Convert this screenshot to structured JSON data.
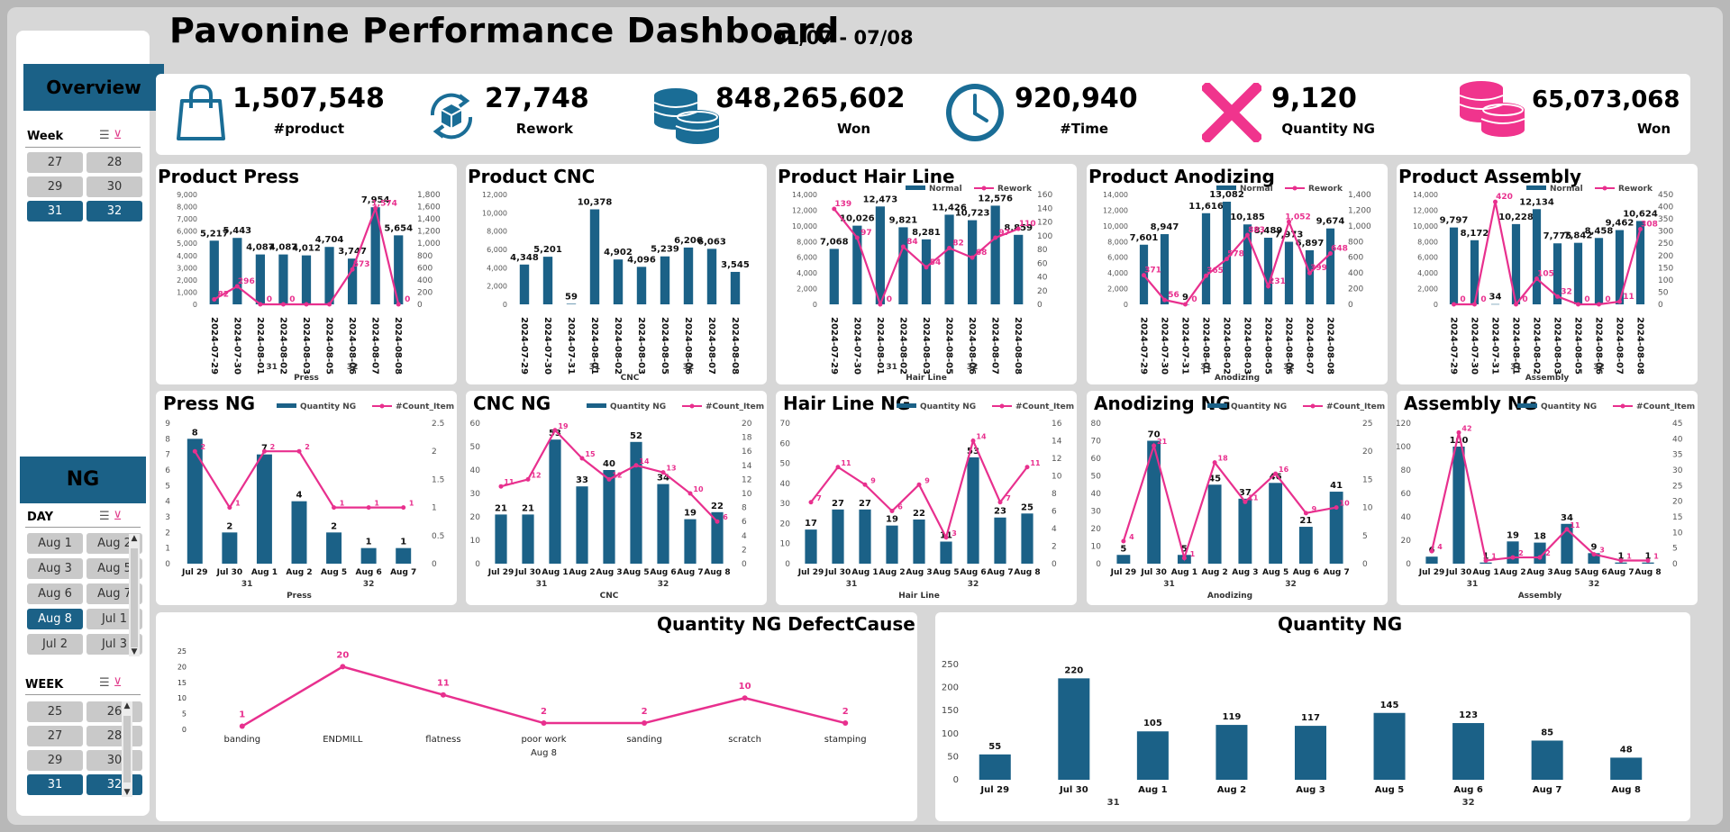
{
  "header": {
    "title": "Pavonine Performance Dashboard",
    "date_range": "01/07 - 07/08"
  },
  "colors": {
    "normal": "#1b6187",
    "rework": "#e8308e",
    "accent_blue": "#1a6d96",
    "accent_pink": "#f0348d"
  },
  "sidebar": {
    "overview": {
      "heading": "Overview",
      "week_title": "Week",
      "week_items": [
        {
          "label": "27",
          "selected": false
        },
        {
          "label": "28",
          "selected": false
        },
        {
          "label": "29",
          "selected": false
        },
        {
          "label": "30",
          "selected": false
        },
        {
          "label": "31",
          "selected": true
        },
        {
          "label": "32",
          "selected": true
        }
      ]
    },
    "ng": {
      "heading": "NG",
      "day_title": "DAY",
      "day_items": [
        {
          "label": "Aug 1",
          "selected": false
        },
        {
          "label": "Aug 2",
          "selected": false
        },
        {
          "label": "Aug 3",
          "selected": false
        },
        {
          "label": "Aug 5",
          "selected": false
        },
        {
          "label": "Aug 6",
          "selected": false
        },
        {
          "label": "Aug 7",
          "selected": false
        },
        {
          "label": "Aug 8",
          "selected": true
        },
        {
          "label": "Jul 1",
          "selected": false
        },
        {
          "label": "Jul 2",
          "selected": false
        },
        {
          "label": "Jul 3",
          "selected": false
        }
      ],
      "week_title": "WEEK",
      "week_items": [
        {
          "label": "25",
          "selected": false
        },
        {
          "label": "26",
          "selected": false
        },
        {
          "label": "27",
          "selected": false
        },
        {
          "label": "28",
          "selected": false
        },
        {
          "label": "29",
          "selected": false
        },
        {
          "label": "30",
          "selected": false
        },
        {
          "label": "31",
          "selected": true
        },
        {
          "label": "32",
          "selected": true
        }
      ]
    }
  },
  "kpis": [
    {
      "icon": "shopping-bag-icon",
      "value": "1,507,548",
      "label": "#product"
    },
    {
      "icon": "rework-box-icon",
      "value": "27,748",
      "label": "Rework"
    },
    {
      "icon": "coins-blue-icon",
      "value": "848,265,602",
      "label": "Won"
    },
    {
      "icon": "clock-icon",
      "value": "920,940",
      "label": "#Time"
    },
    {
      "icon": "cross-icon",
      "value": "9,120",
      "label": "Quantity NG"
    },
    {
      "icon": "coins-pink-icon",
      "value": "65,073,068",
      "label": "Won"
    }
  ],
  "chart_data": [
    {
      "id": "press",
      "type": "bar",
      "title": "Product Press",
      "categories": [
        "2024-07-29",
        "2024-07-30",
        "2024-08-01",
        "2024-08-02",
        "2024-08-03",
        "2024-08-05",
        "2024-08-06",
        "2024-08-07",
        "2024-08-08"
      ],
      "values": [
        5217,
        5443,
        4087,
        4087,
        4012,
        4704,
        3747,
        7954,
        5654
      ],
      "labels": [
        "5,217",
        "5,443",
        "4,087",
        "4,087",
        "4,012",
        "4,704",
        "3,747",
        "7,954",
        "5,654"
      ],
      "line": [
        82,
        296,
        0,
        0,
        0,
        0,
        572,
        1574,
        0
      ],
      "line_labels": [
        "82",
        "296",
        "0",
        "0",
        "",
        "",
        "573",
        "1,574",
        "0"
      ],
      "ylim": [
        0,
        9000
      ],
      "y_ticks": [
        "0",
        "1,000",
        "2,000",
        "3,000",
        "4,000",
        "5,000",
        "6,000",
        "7,000",
        "8,000",
        "9,000"
      ],
      "y2lim": [
        0,
        1800
      ],
      "y2_ticks": [
        "0",
        "200",
        "400",
        "600",
        "800",
        "1,000",
        "1,200",
        "1,400",
        "1,600",
        "1,800"
      ],
      "groups": [
        {
          "label": "31",
          "from": 2,
          "to": 3
        },
        {
          "label": "32",
          "from": 4,
          "to": 8
        }
      ],
      "xlabel": "Press"
    },
    {
      "id": "cnc",
      "type": "bar",
      "title": "Product CNC",
      "categories": [
        "2024-07-29",
        "2024-07-30",
        "2024-07-31",
        "2024-08-01",
        "2024-08-02",
        "2024-08-03",
        "2024-08-05",
        "2024-08-06",
        "2024-08-07",
        "2024-08-08"
      ],
      "values": [
        4348,
        5201,
        59,
        10378,
        4902,
        4096,
        5239,
        6206,
        6063,
        3545
      ],
      "labels": [
        "4,348",
        "5,201",
        "59",
        "10,378",
        "4,902",
        "4,096",
        "5,239",
        "6,206",
        "6,063",
        "3,545"
      ],
      "ylim": [
        0,
        12000
      ],
      "y_ticks": [
        "0",
        "2,000",
        "4,000",
        "6,000",
        "8,000",
        "10,000",
        "12,000"
      ],
      "groups": [
        {
          "label": "31",
          "from": 2,
          "to": 4
        },
        {
          "label": "32",
          "from": 5,
          "to": 9
        }
      ],
      "xlabel": "CNC"
    },
    {
      "id": "hairline",
      "type": "bar",
      "title": "Product Hair Line",
      "legend": [
        "Normal",
        "Rework"
      ],
      "categories": [
        "2024-07-29",
        "2024-07-30",
        "2024-08-01",
        "2024-08-02",
        "2024-08-03",
        "2024-08-05",
        "2024-08-06",
        "2024-08-07",
        "2024-08-08"
      ],
      "values": [
        7068,
        10026,
        12473,
        9821,
        8281,
        11426,
        10723,
        12576,
        8859
      ],
      "labels": [
        "7,068",
        "10,026",
        "12,473",
        "9,821",
        "8,281",
        "11,426",
        "10,723",
        "12,576",
        "8,859"
      ],
      "line": [
        139,
        97,
        0,
        84,
        54,
        82,
        68,
        97,
        110
      ],
      "line_labels": [
        "139",
        "97",
        "0",
        "84",
        "54",
        "82",
        "68",
        "97",
        "110"
      ],
      "ylim": [
        0,
        14000
      ],
      "y_ticks": [
        "0",
        "2,000",
        "4,000",
        "6,000",
        "8,000",
        "10,000",
        "12,000",
        "14,000"
      ],
      "y2lim": [
        0,
        160
      ],
      "y2_ticks": [
        "0",
        "20",
        "40",
        "60",
        "80",
        "100",
        "120",
        "140",
        "160"
      ],
      "groups": [
        {
          "label": "31",
          "from": 2,
          "to": 3
        },
        {
          "label": "32",
          "from": 4,
          "to": 8
        }
      ],
      "xlabel": "Hair Line"
    },
    {
      "id": "anodizing",
      "type": "bar",
      "title": "Product Anodizing",
      "legend": [
        "Normal",
        "Rework"
      ],
      "categories": [
        "2024-07-29",
        "2024-07-30",
        "2024-07-31",
        "2024-08-01",
        "2024-08-02",
        "2024-08-03",
        "2024-08-05",
        "2024-08-06",
        "2024-08-07",
        "2024-08-08"
      ],
      "values": [
        7601,
        8947,
        9,
        11616,
        13082,
        10185,
        8489,
        7973,
        6897,
        9674
      ],
      "labels": [
        "7,601",
        "8,947",
        "9",
        "11,616",
        "13,082",
        "10,185",
        "8,489",
        "7,973",
        "6,897",
        "9,674"
      ],
      "line": [
        371,
        56,
        0,
        365,
        578,
        883,
        231,
        1052,
        399,
        648
      ],
      "line_labels": [
        "371",
        "56",
        "0",
        "365",
        "578",
        "883",
        "231",
        "1,052",
        "399",
        "648"
      ],
      "ylim": [
        0,
        14000
      ],
      "y_ticks": [
        "0",
        "2,000",
        "4,000",
        "6,000",
        "8,000",
        "10,000",
        "12,000",
        "14,000"
      ],
      "y2lim": [
        0,
        1400
      ],
      "y2_ticks": [
        "0",
        "200",
        "400",
        "600",
        "800",
        "1,000",
        "1,200",
        "1,400"
      ],
      "groups": [
        {
          "label": "31",
          "from": 2,
          "to": 4
        },
        {
          "label": "32",
          "from": 5,
          "to": 9
        }
      ],
      "xlabel": "Anodizing"
    },
    {
      "id": "assembly",
      "type": "bar",
      "title": "Product Assembly",
      "legend": [
        "Normal",
        "Rework"
      ],
      "categories": [
        "2024-07-29",
        "2024-07-30",
        "2024-07-31",
        "2024-08-01",
        "2024-08-02",
        "2024-08-03",
        "2024-08-05",
        "2024-08-06",
        "2024-08-07",
        "2024-08-08"
      ],
      "values": [
        9797,
        8172,
        34,
        10228,
        12134,
        7775,
        7842,
        8458,
        9462,
        10624
      ],
      "labels": [
        "9,797",
        "8,172",
        "34",
        "10,228",
        "12,134",
        "7,775",
        "7,842",
        "8,458",
        "9,462",
        "10,624"
      ],
      "line": [
        0,
        0,
        420,
        0,
        105,
        32,
        0,
        0,
        11,
        308
      ],
      "line_labels": [
        "0",
        "0",
        "420",
        "0",
        "105",
        "32",
        "0",
        "0",
        "11",
        "308"
      ],
      "ylim": [
        0,
        14000
      ],
      "y_ticks": [
        "0",
        "2,000",
        "4,000",
        "6,000",
        "8,000",
        "10,000",
        "12,000",
        "14,000"
      ],
      "y2lim": [
        0,
        450
      ],
      "y2_ticks": [
        "0",
        "50",
        "100",
        "150",
        "200",
        "250",
        "300",
        "350",
        "400",
        "450"
      ],
      "groups": [
        {
          "label": "31",
          "from": 2,
          "to": 4
        },
        {
          "label": "32",
          "from": 5,
          "to": 9
        }
      ],
      "xlabel": "Assembly"
    },
    {
      "id": "press_ng",
      "type": "bar",
      "title": "Press NG",
      "legend": [
        "Quantity NG",
        "#Count_Item"
      ],
      "categories": [
        "Jul 29",
        "Jul 30",
        "Aug 1",
        "Aug 2",
        "Aug 5",
        "Aug 6",
        "Aug 7"
      ],
      "values": [
        8,
        2,
        7,
        4,
        2,
        1,
        1
      ],
      "line": [
        2,
        1,
        2,
        2,
        1,
        1,
        1
      ],
      "ylim": [
        0,
        9
      ],
      "y_ticks": [
        "0",
        "1",
        "2",
        "3",
        "4",
        "5",
        "6",
        "7",
        "8",
        "9"
      ],
      "y2lim": [
        0,
        2.5
      ],
      "y2_ticks": [
        "0",
        "0.5",
        "1",
        "1.5",
        "2",
        "2.5"
      ],
      "groups": [
        {
          "label": "31",
          "from": 0,
          "to": 3
        },
        {
          "label": "32",
          "from": 4,
          "to": 6
        }
      ],
      "xlabel": "Press"
    },
    {
      "id": "cnc_ng",
      "type": "bar",
      "title": "CNC NG",
      "legend": [
        "Quantity NG",
        "#Count_Item"
      ],
      "categories": [
        "Jul 29",
        "Jul 30",
        "Aug 1",
        "Aug 2",
        "Aug 3",
        "Aug 5",
        "Aug 6",
        "Aug 7",
        "Aug 8"
      ],
      "values": [
        21,
        21,
        53,
        33,
        40,
        52,
        34,
        19,
        22
      ],
      "line": [
        11,
        12,
        19,
        15,
        12,
        14,
        13,
        10,
        6
      ],
      "ylim": [
        0,
        60
      ],
      "y_ticks": [
        "0",
        "10",
        "20",
        "30",
        "40",
        "50",
        "60"
      ],
      "y2lim": [
        0,
        20
      ],
      "y2_ticks": [
        "0",
        "2",
        "4",
        "6",
        "8",
        "10",
        "12",
        "14",
        "16",
        "18",
        "20"
      ],
      "groups": [
        {
          "label": "31",
          "from": 0,
          "to": 3
        },
        {
          "label": "32",
          "from": 4,
          "to": 8
        }
      ],
      "xlabel": "CNC"
    },
    {
      "id": "hairline_ng",
      "type": "bar",
      "title": "Hair Line NG",
      "legend": [
        "Quantity NG",
        "#Count_Item"
      ],
      "categories": [
        "Jul 29",
        "Jul 30",
        "Aug 1",
        "Aug 2",
        "Aug 3",
        "Aug 5",
        "Aug 6",
        "Aug 7",
        "Aug 8"
      ],
      "values": [
        17,
        27,
        27,
        19,
        22,
        11,
        53,
        23,
        25
      ],
      "line": [
        7,
        11,
        9,
        6,
        9,
        3,
        14,
        7,
        11
      ],
      "ylim": [
        0,
        70
      ],
      "y_ticks": [
        "0",
        "10",
        "20",
        "30",
        "40",
        "50",
        "60",
        "70"
      ],
      "y2lim": [
        0,
        16
      ],
      "y2_ticks": [
        "0",
        "2",
        "4",
        "6",
        "8",
        "10",
        "12",
        "14",
        "16"
      ],
      "groups": [
        {
          "label": "31",
          "from": 0,
          "to": 3
        },
        {
          "label": "32",
          "from": 4,
          "to": 8
        }
      ],
      "xlabel": "Hair Line"
    },
    {
      "id": "anodizing_ng",
      "type": "bar",
      "title": "Anodizing NG",
      "legend": [
        "Quantity NG",
        "#Count_Item"
      ],
      "categories": [
        "Jul 29",
        "Jul 30",
        "Aug 1",
        "Aug 2",
        "Aug 3",
        "Aug 5",
        "Aug 6",
        "Aug 7"
      ],
      "values": [
        5,
        70,
        5,
        45,
        37,
        46,
        21,
        41
      ],
      "line": [
        4,
        21,
        1,
        18,
        11,
        16,
        9,
        10
      ],
      "ylim": [
        0,
        80
      ],
      "y_ticks": [
        "0",
        "10",
        "20",
        "30",
        "40",
        "50",
        "60",
        "70",
        "80"
      ],
      "y2lim": [
        0,
        25
      ],
      "y2_ticks": [
        "0",
        "5",
        "10",
        "15",
        "20",
        "25"
      ],
      "groups": [
        {
          "label": "31",
          "from": 0,
          "to": 3
        },
        {
          "label": "32",
          "from": 4,
          "to": 7
        }
      ],
      "xlabel": "Anodizing"
    },
    {
      "id": "assembly_ng",
      "type": "bar",
      "title": "Assembly NG",
      "legend": [
        "Quantity NG",
        "#Count_Item"
      ],
      "categories": [
        "Jul 29",
        "Jul 30",
        "Aug 1",
        "Aug 2",
        "Aug 3",
        "Aug 5",
        "Aug 6",
        "Aug 7",
        "Aug 8"
      ],
      "values": [
        6,
        100,
        1,
        19,
        18,
        34,
        9,
        1,
        1
      ],
      "line": [
        4,
        42,
        1,
        2,
        2,
        11,
        3,
        1,
        1
      ],
      "ylim": [
        0,
        120
      ],
      "y_ticks": [
        "0",
        "20",
        "40",
        "60",
        "80",
        "100",
        "120"
      ],
      "y2lim": [
        0,
        45
      ],
      "y2_ticks": [
        "0",
        "5",
        "10",
        "15",
        "20",
        "25",
        "30",
        "35",
        "40",
        "45"
      ],
      "groups": [
        {
          "label": "31",
          "from": 0,
          "to": 3
        },
        {
          "label": "32",
          "from": 4,
          "to": 8
        }
      ],
      "xlabel": "Assembly"
    },
    {
      "id": "defect_cause",
      "type": "line",
      "title": "Quantity NG DefectCause",
      "categories": [
        "banding",
        "ENDMILL",
        "flatness",
        "poor work",
        "sanding",
        "scratch",
        "stamping"
      ],
      "values": [
        1,
        20,
        11,
        2,
        2,
        10,
        2
      ],
      "ylim": [
        0,
        25
      ],
      "y_ticks": [
        "0",
        "5",
        "10",
        "15",
        "20",
        "25"
      ],
      "xlabel": "Aug 8"
    },
    {
      "id": "quantity_ng",
      "type": "bar",
      "title": "Quantity NG",
      "categories": [
        "Jul 29",
        "Jul 30",
        "Aug 1",
        "Aug 2",
        "Aug 3",
        "Aug 5",
        "Aug 6",
        "Aug 7",
        "Aug 8"
      ],
      "values": [
        55,
        220,
        105,
        119,
        117,
        145,
        123,
        85,
        48
      ],
      "ylim": [
        0,
        250
      ],
      "y_ticks": [
        "0",
        "50",
        "100",
        "150",
        "200",
        "250"
      ],
      "groups": [
        {
          "label": "31",
          "from": 0,
          "to": 3
        },
        {
          "label": "32",
          "from": 4,
          "to": 8
        }
      ]
    }
  ]
}
